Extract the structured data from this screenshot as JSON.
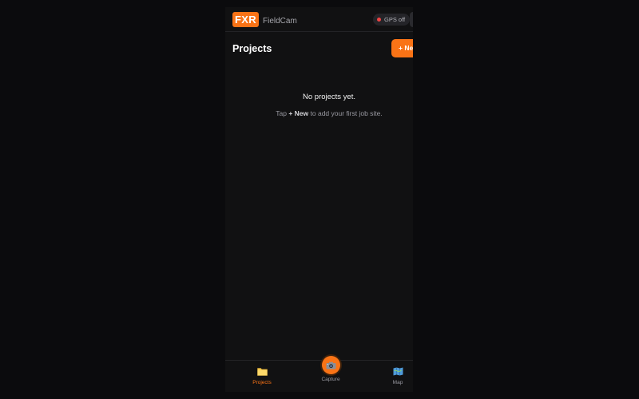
{
  "header": {
    "logo_text": "FXR",
    "app_name": "FieldCam",
    "gps_status": "GPS off"
  },
  "main": {
    "title": "Projects",
    "new_button_label": "+ New",
    "empty_title": "No projects yet.",
    "empty_hint_prefix": "Tap",
    "empty_hint_action": "+ New",
    "empty_hint_suffix": "to add your first job site."
  },
  "bottom_nav": {
    "items": [
      {
        "label": "Projects",
        "icon": "folder-icon",
        "active": true
      },
      {
        "label": "Capture",
        "icon": "camera-icon",
        "active": false
      },
      {
        "label": "Map",
        "icon": "map-icon",
        "active": false
      }
    ]
  },
  "colors": {
    "accent": "#f97316",
    "background": "#111112",
    "gps_off_dot": "#ef4444"
  }
}
